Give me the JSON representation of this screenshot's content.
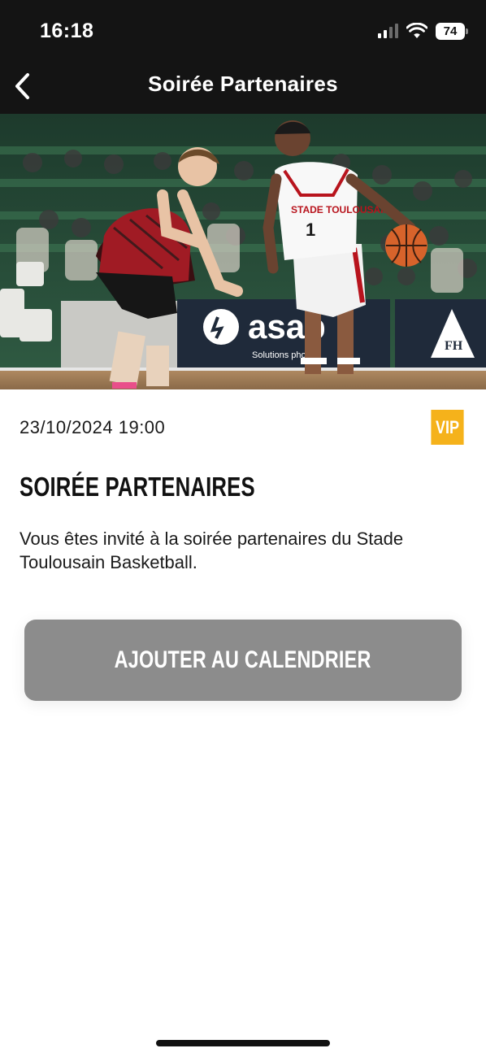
{
  "status_bar": {
    "time": "16:18",
    "battery": "74",
    "icons": [
      "cellular-signal-icon",
      "wifi-icon",
      "battery-icon"
    ]
  },
  "header": {
    "title": "Soirée Partenaires",
    "back_icon": "chevron-left-icon"
  },
  "hero": {
    "jersey_team": "STADE TOULOUSAIN",
    "jersey_number": "1",
    "banner_brand": "asap",
    "banner_tagline": "Solutions photo",
    "banner_right": "FH"
  },
  "event": {
    "datetime": "23/10/2024 19:00",
    "badge": "VIP",
    "title": "SOIRÉE PARTENAIRES",
    "description": "Vous êtes invité à la soirée partenaires du Stade Toulousain Basketball."
  },
  "actions": {
    "add_to_calendar": "AJOUTER AU CALENDRIER"
  },
  "colors": {
    "header_bg": "#141414",
    "badge_bg": "#f5b21b",
    "button_bg": "#8c8c8c",
    "text": "#1a1a1a"
  }
}
